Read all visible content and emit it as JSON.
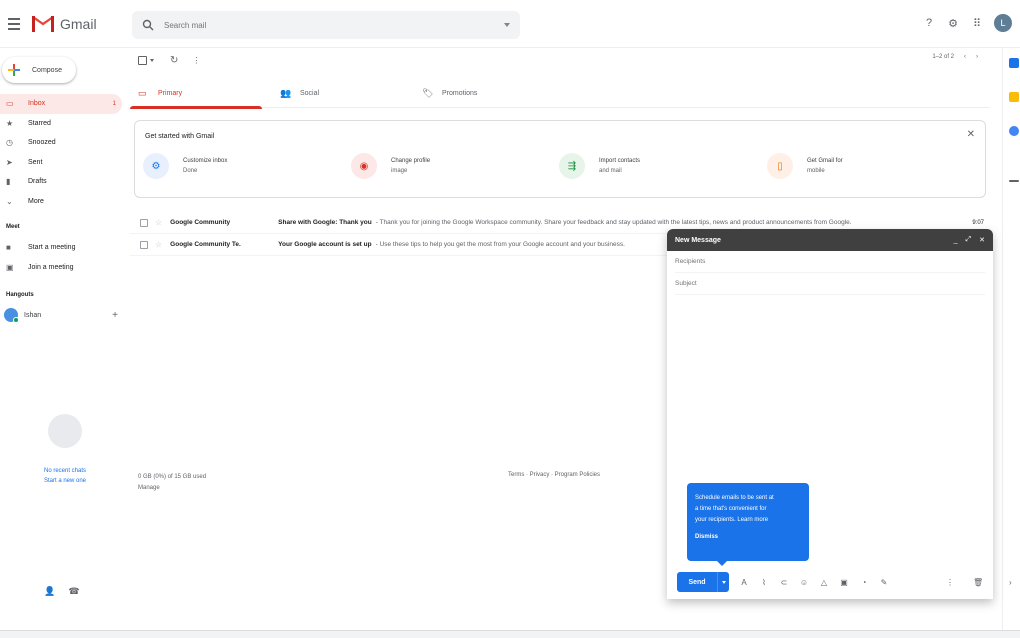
{
  "header": {
    "app_name": "Gmail",
    "search_placeholder": "Search mail",
    "avatar_letter": "L"
  },
  "sidebar": {
    "compose_label": "Compose",
    "items": [
      {
        "label": "Inbox",
        "icon": "inbox-icon",
        "glyph": "▭",
        "count": "1",
        "active": true
      },
      {
        "label": "Starred",
        "icon": "star-icon",
        "glyph": "★",
        "count": "",
        "active": false
      },
      {
        "label": "Snoozed",
        "icon": "clock-icon",
        "glyph": "◷",
        "count": "",
        "active": false
      },
      {
        "label": "Sent",
        "icon": "send-icon",
        "glyph": "➤",
        "count": "",
        "active": false
      },
      {
        "label": "Drafts",
        "icon": "draft-icon",
        "glyph": "▮",
        "count": "",
        "active": false
      },
      {
        "label": "More",
        "icon": "chevron-down-icon",
        "glyph": "⌄",
        "count": "",
        "active": false
      }
    ],
    "meet_heading": "Meet",
    "meet_items": [
      {
        "label": "Start a meeting",
        "icon": "video-icon",
        "glyph": "■"
      },
      {
        "label": "Join a meeting",
        "icon": "keyboard-icon",
        "glyph": "▣"
      }
    ],
    "hangouts_heading": "Hangouts",
    "hangouts_user": "Ishan",
    "hangouts_empty_line1": "No recent chats",
    "hangouts_empty_line2": "Start a new one"
  },
  "toolbar": {
    "pager": "1–2 of 2"
  },
  "tabs": [
    {
      "label": "Primary",
      "icon": "inbox-tab-icon",
      "glyph": "▭",
      "active": true
    },
    {
      "label": "Social",
      "icon": "people-icon",
      "glyph": "👥",
      "active": false
    },
    {
      "label": "Promotions",
      "icon": "tag-icon",
      "glyph": "🏷",
      "active": false
    }
  ],
  "get_started": {
    "title": "Get started with Gmail",
    "items": [
      {
        "line1": "Customize inbox",
        "line2": "Done",
        "color": "#e8f0fe",
        "fg": "#1a73e8",
        "glyph": "⚙",
        "icon": "gear-icon"
      },
      {
        "line1": "Change profile",
        "line2": "image",
        "color": "#fce8e6",
        "fg": "#d93025",
        "glyph": "◉",
        "icon": "camera-icon"
      },
      {
        "line1": "Import contacts",
        "line2": "and mail",
        "color": "#e6f4ea",
        "fg": "#1e8e3e",
        "glyph": "⇶",
        "icon": "import-icon"
      },
      {
        "line1": "Get Gmail for",
        "line2": "mobile",
        "color": "#fef0e6",
        "fg": "#e8710a",
        "glyph": "▯",
        "icon": "phone-icon"
      }
    ]
  },
  "emails": [
    {
      "sender": "Google Community",
      "subject": "Share with Google: Thank you",
      "snippet": " - Thank you for joining the Google Workspace community. Share your feedback and stay updated with the latest tips, news and product announcements from Google.",
      "date": "9:07"
    },
    {
      "sender": "Google Community Te.",
      "subject": "Your Google account is set up",
      "snippet": " - Use these tips to help you get the most from your Google account and your business.",
      "date": ""
    }
  ],
  "footer": {
    "storage_line1": "0 GB (0%) of 15 GB used",
    "storage_line2": "Manage",
    "mid": "Terms · Privacy · Program Policies"
  },
  "compose": {
    "title": "New Message",
    "to_placeholder": "Recipients",
    "subject_placeholder": "Subject",
    "tooltip_line1": "Schedule emails to be sent at",
    "tooltip_line2": "a time that's convenient for",
    "tooltip_line3": "your recipients. Learn more",
    "tooltip_dismiss": "Dismiss",
    "send_label": "Send"
  }
}
